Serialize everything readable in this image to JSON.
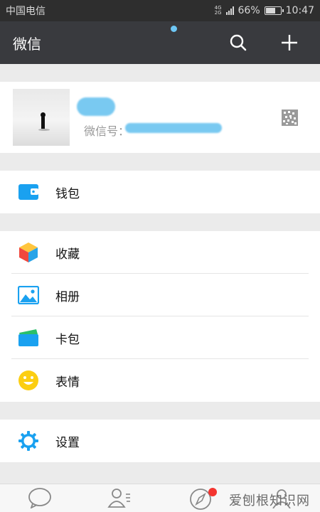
{
  "status_bar": {
    "carrier": "中国电信",
    "network_top": "4G",
    "network_bottom": "2G",
    "battery_percent": "66%",
    "battery_level": 0.66,
    "time": "10:47"
  },
  "header": {
    "title": "微信",
    "search_icon": "search-icon",
    "add_icon": "plus-icon"
  },
  "profile": {
    "wechat_id_label": "微信号：",
    "qr_icon": "qr-code-icon"
  },
  "menu": {
    "wallet": {
      "label": "钱包",
      "icon": "wallet-icon",
      "color": "#1aa1f0"
    },
    "favorites": {
      "label": "收藏",
      "icon": "favorites-cube-icon"
    },
    "album": {
      "label": "相册",
      "icon": "album-icon",
      "color": "#1aa1f0"
    },
    "cards": {
      "label": "卡包",
      "icon": "card-wallet-icon"
    },
    "stickers": {
      "label": "表情",
      "icon": "smiley-icon",
      "color": "#fcce12"
    },
    "settings": {
      "label": "设置",
      "icon": "settings-gear-icon",
      "color": "#1aa1f0"
    }
  },
  "tabbar": {
    "tabs": [
      {
        "name": "chats",
        "icon": "chat-bubble-icon"
      },
      {
        "name": "contacts",
        "icon": "contacts-icon"
      },
      {
        "name": "discover",
        "icon": "compass-icon"
      },
      {
        "name": "me",
        "icon": "me-icon"
      }
    ]
  },
  "watermark": {
    "text": "爱刨根知识网"
  }
}
